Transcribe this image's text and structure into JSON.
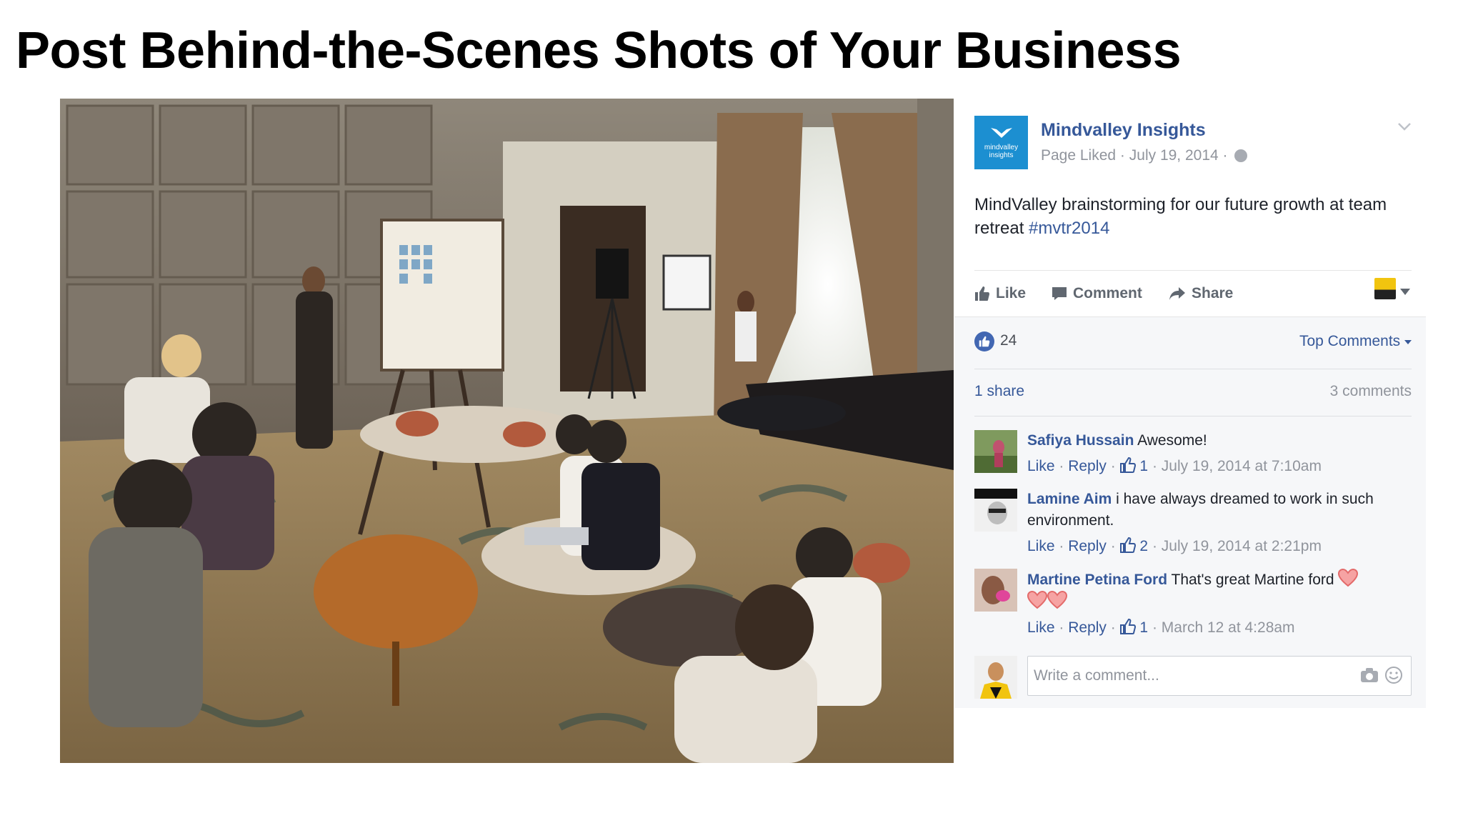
{
  "slide": {
    "title": "Post Behind-the-Scenes Shots of Your Business"
  },
  "post": {
    "page_name": "Mindvalley Insights",
    "logo_text": "mindvalley insights",
    "liked_label": "Page Liked",
    "date": "July 19, 2014",
    "meta_sep": " · ",
    "text": "MindValley brainstorming for our future growth at team retreat ",
    "hashtag": "#mvtr2014",
    "actions": {
      "like": "Like",
      "comment": "Comment",
      "share": "Share"
    },
    "reactions_count": "24",
    "top_comments_label": "Top Comments",
    "shares_label": "1 share",
    "comments_count_label": "3 comments",
    "comments": [
      {
        "author": "Safiya Hussain",
        "text": "Awesome!",
        "like": "Like",
        "reply": "Reply",
        "likes": "1",
        "timestamp": "July 19, 2014 at 7:10am"
      },
      {
        "author": "Lamine Aim",
        "text": "i have always dreamed to work in such environment.",
        "like": "Like",
        "reply": "Reply",
        "likes": "2",
        "timestamp": "July 19, 2014 at 2:21pm"
      },
      {
        "author": "Martine Petina Ford",
        "text": "That's great Martine ford",
        "like": "Like",
        "reply": "Reply",
        "likes": "1",
        "timestamp": "March 12 at 4:28am"
      }
    ],
    "write_placeholder": "Write a comment...",
    "colors": {
      "link": "#365899",
      "meta": "#90949c",
      "like_badge": "#4267b2",
      "logo_bg": "#1c8fd1"
    }
  },
  "icons": [
    "globe-icon",
    "chevron-down-icon",
    "like-icon",
    "comment-icon",
    "share-icon",
    "thumbs-up-icon",
    "camera-icon",
    "smiley-icon",
    "heart-emoji"
  ]
}
